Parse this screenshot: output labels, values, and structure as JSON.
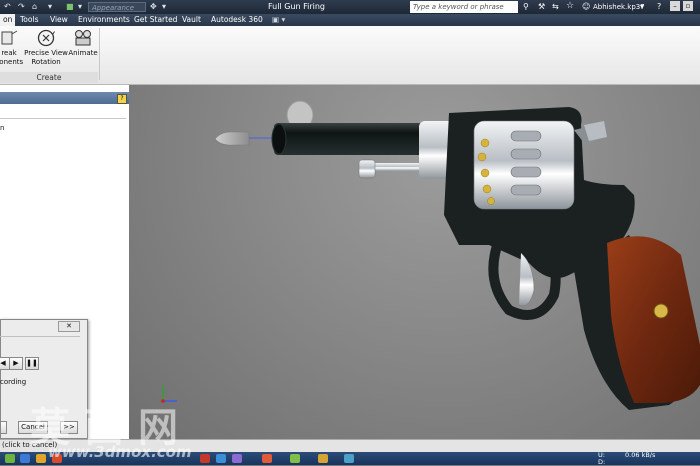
{
  "titlebar": {
    "appearance_value": "Appearance",
    "document_title": "Full Gun Firing",
    "search_placeholder": "Type a keyword or phrase",
    "user_name": "Abhishek.kp37"
  },
  "menu": {
    "tabs": [
      {
        "label": "on",
        "active": true
      },
      {
        "label": "Tools"
      },
      {
        "label": "View"
      },
      {
        "label": "Environments"
      },
      {
        "label": "Get Started"
      },
      {
        "label": "Vault"
      },
      {
        "label": "Autodesk 360"
      }
    ]
  },
  "ribbon": {
    "buttons": [
      {
        "label": "reak\nponents",
        "icon": "tweak-components-icon"
      },
      {
        "label": "Precise View\nRotation",
        "icon": "precise-view-rotation-icon"
      },
      {
        "label": "Animate",
        "icon": "animate-camera-icon"
      }
    ],
    "group_label": "Create"
  },
  "browser_panel": {
    "help_glyph": "?",
    "item": "n"
  },
  "animate_dialog": {
    "close_glyph": "✕",
    "recording_label": "cording",
    "cancel_label": "Cancel",
    "next_label": ">>"
  },
  "statusbar": {
    "text": "(click to cancel)"
  },
  "taskbar": {
    "net_up": "U:",
    "net_down": "D:",
    "net_speed": "0.06 kB/s"
  },
  "watermark": {
    "chinese": "莫西网",
    "url": "www.3dmox.com"
  },
  "colors": {
    "viewport_bg": "#8a8a8a",
    "grip_wood": "#7a2e12",
    "frame_black": "#1b2020",
    "cylinder_silver": "#c9cfd4",
    "brass": "#d6b33c"
  }
}
